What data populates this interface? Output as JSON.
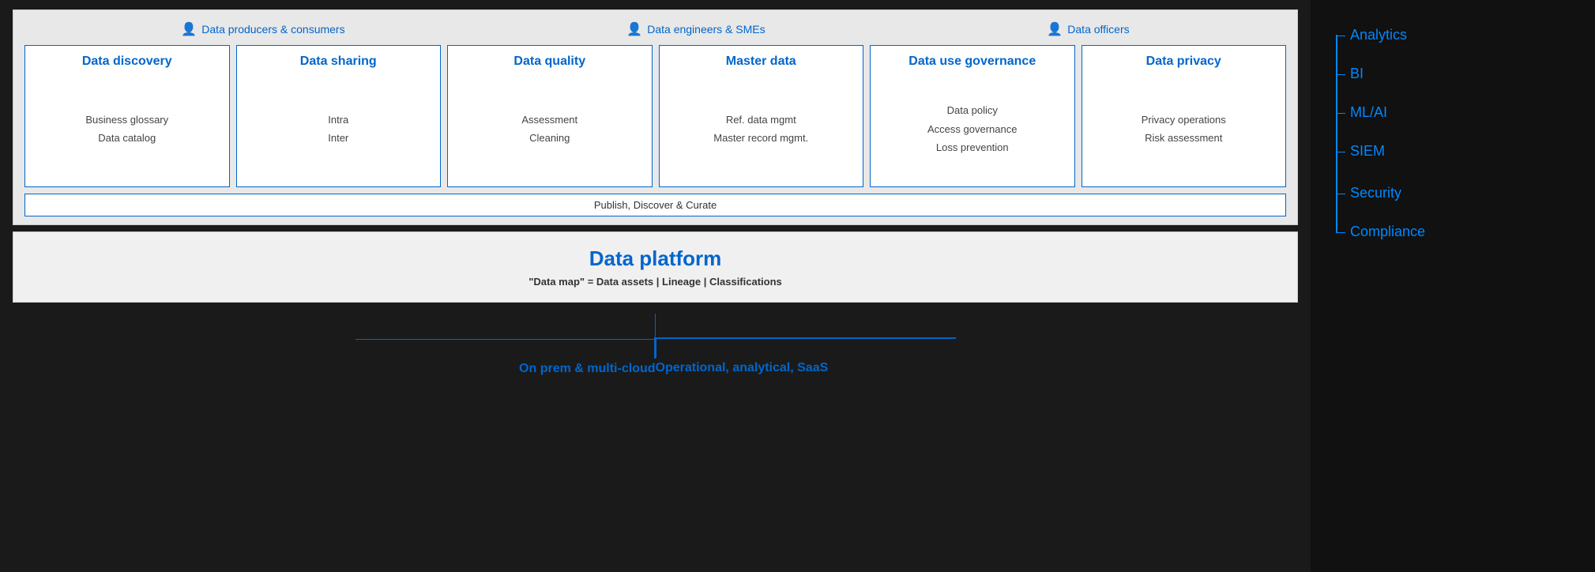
{
  "personas": [
    {
      "icon": "👤",
      "label": "Data producers & consumers"
    },
    {
      "icon": "👤",
      "label": "Data engineers & SMEs"
    },
    {
      "icon": "👤",
      "label": "Data officers"
    }
  ],
  "cards": [
    {
      "title": "Data discovery",
      "items": [
        "Business glossary",
        "Data catalog"
      ],
      "persona_index": 0
    },
    {
      "title": "Data sharing",
      "items": [
        "Intra",
        "Inter"
      ],
      "persona_index": 0
    },
    {
      "title": "Data quality",
      "items": [
        "Assessment",
        "Cleaning"
      ],
      "persona_index": 1
    },
    {
      "title": "Master data",
      "items": [
        "Ref. data mgmt",
        "Master record mgmt."
      ],
      "persona_index": 1
    },
    {
      "title": "Data use governance",
      "items": [
        "Data policy",
        "Access governance",
        "Loss prevention"
      ],
      "persona_index": 2
    },
    {
      "title": "Data privacy",
      "items": [
        "Privacy operations",
        "Risk assessment"
      ],
      "persona_index": 2
    }
  ],
  "publish_bar": "Publish, Discover & Curate",
  "data_platform": {
    "title": "Data platform",
    "subtitle": "\"Data map\" = Data assets | Lineage | Classifications"
  },
  "bottom_labels": [
    "On prem & multi-cloud",
    "Operational, analytical, SaaS"
  ],
  "sidebar_items": [
    "Analytics",
    "BI",
    "ML/AI",
    "SIEM",
    "Security",
    "Compliance"
  ]
}
